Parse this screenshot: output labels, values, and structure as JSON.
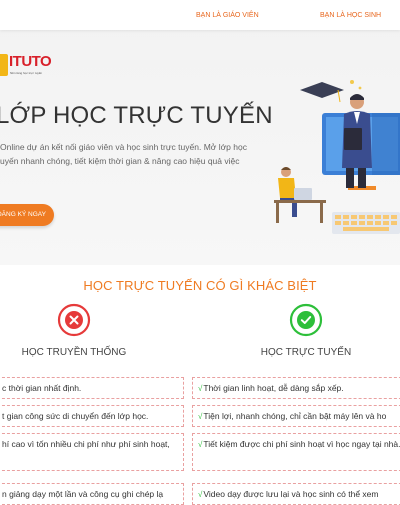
{
  "nav": {
    "links": [
      "BẠN LÀ GIÁO VIÊN",
      "BẠN LÀ HỌC SINH"
    ]
  },
  "logo": {
    "text": "ITUTO",
    "sub": "Nền tảng học trực tuyến"
  },
  "hero": {
    "title": "LỚP HỌC TRỰC TUYẾN",
    "description_line1": "Online dự án kết nối giáo viên và học sinh trực tuyến. Mở lớp học",
    "description_line2": "uyến nhanh chóng, tiết kiệm thời gian & nâng cao hiệu quả việc",
    "cta_label": "ĐĂNG KÝ NGAY"
  },
  "compare": {
    "title": "HỌC TRỰC TUYẾN CÓ GÌ KHÁC BIỆT",
    "left_label": "HỌC TRUYỀN THỐNG",
    "right_label": "HỌC TRỰC TUYẾN",
    "left_icon": "x-circle-icon",
    "right_icon": "check-circle-icon",
    "left_color": "#e63a3a",
    "right_color": "#2dbf3a",
    "left_rows": [
      "c thời gian nhất định.",
      "t gian công sức di chuyển đến lớp học.",
      "hí cao vì tốn nhiều chi phí như phí sinh hoạt,",
      "n giảng dạy một lần và công cụ ghi chép lạ"
    ],
    "right_rows": [
      "Thời gian linh hoạt, dễ dàng sắp xếp.",
      "Tiện lợi, nhanh chóng, chỉ cần bật máy lên và ho",
      "Tiết kiệm được chi phí sinh hoạt vì học ngay tại nhà.",
      "Video dạy được lưu lại và học sinh có thể xem"
    ]
  }
}
